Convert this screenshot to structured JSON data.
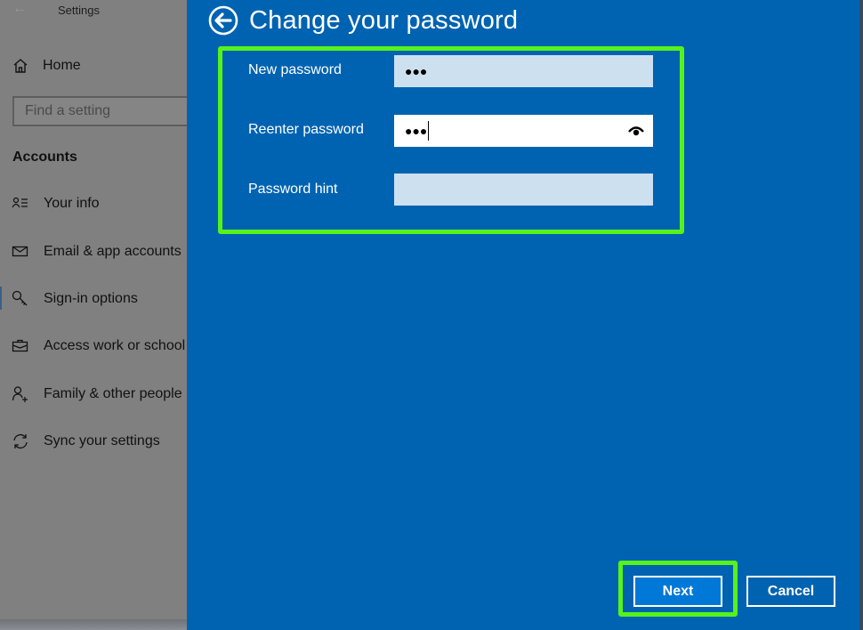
{
  "settings": {
    "title": "Settings",
    "home_label": "Home",
    "search_placeholder": "Find a setting",
    "section_title": "Accounts",
    "nav_items": [
      {
        "label": "Your info",
        "icon": "contact-info-icon"
      },
      {
        "label": "Email & app accounts",
        "icon": "mail-icon"
      },
      {
        "label": "Sign-in options",
        "icon": "key-icon",
        "selected": true
      },
      {
        "label": "Access work or school",
        "icon": "briefcase-icon"
      },
      {
        "label": "Family & other people",
        "icon": "add-person-icon"
      },
      {
        "label": "Sync your settings",
        "icon": "sync-icon"
      }
    ]
  },
  "dialog": {
    "title": "Change your password",
    "fields": [
      {
        "label": "New password",
        "value": "●●●",
        "focused": false
      },
      {
        "label": "Reenter password",
        "value": "●●●",
        "focused": true
      },
      {
        "label": "Password hint",
        "value": "",
        "focused": false
      }
    ],
    "buttons": {
      "next": "Next",
      "cancel": "Cancel"
    }
  },
  "colors": {
    "dialog_bg": "#0063b1",
    "highlight": "#55f31a",
    "primary_button": "#0078d7",
    "field_bg": "#cde0f0"
  }
}
